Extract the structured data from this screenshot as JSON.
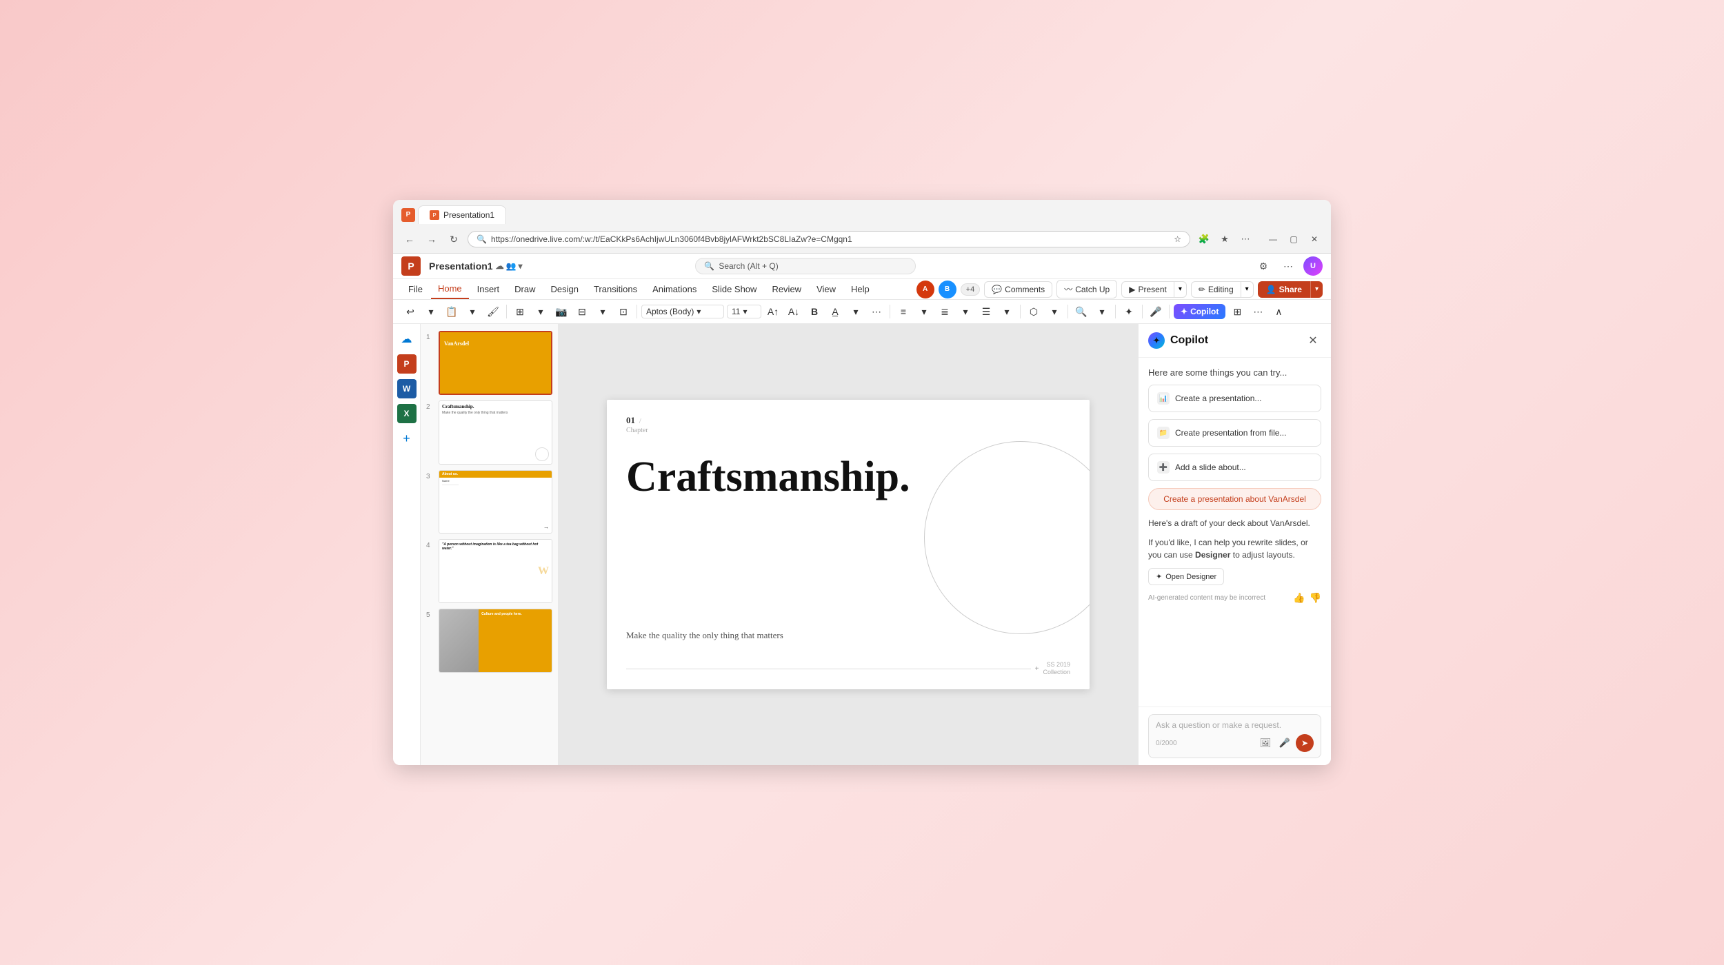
{
  "browser": {
    "url": "https://onedrive.live.com/:w:/t/EaCKkPs6AchIjwULn3060f4Bvb8jylAFWrkt2bSC8LIaZw?e=CMgqn1",
    "tab_label": "Presentation1"
  },
  "app": {
    "title": "Presentation1",
    "search_placeholder": "Search (Alt + Q)"
  },
  "menu": {
    "items": [
      "File",
      "Home",
      "Insert",
      "Draw",
      "Design",
      "Transitions",
      "Animations",
      "Slide Show",
      "Review",
      "View",
      "Help"
    ],
    "active": "Home"
  },
  "toolbar": {
    "font": "Aptos (Body)",
    "font_size": "11",
    "copilot_label": "Copilot"
  },
  "ribbon_actions": {
    "comments": "Comments",
    "catch_up": "Catch Up",
    "present": "Present",
    "editing": "Editing",
    "share": "Share"
  },
  "slides": [
    {
      "num": "1",
      "type": "title_slide"
    },
    {
      "num": "2",
      "type": "craftsmanship"
    },
    {
      "num": "3",
      "type": "about"
    },
    {
      "num": "4",
      "type": "quote"
    },
    {
      "num": "5",
      "type": "culture"
    }
  ],
  "main_slide": {
    "chapter_num": "01",
    "chapter_sep": "/",
    "chapter_label": "Chapter",
    "title": "Craftsmanship.",
    "subtitle": "Make the quality the only thing that matters",
    "footer_year": "SS 2019",
    "footer_collection": "Collection"
  },
  "copilot": {
    "title": "Copilot",
    "hint": "Here are some things you can try...",
    "actions": [
      {
        "label": "Create a presentation...",
        "icon": "📊"
      },
      {
        "label": "Create presentation from file...",
        "icon": "📁"
      },
      {
        "label": "Add a slide about...",
        "icon": "➕"
      }
    ],
    "generate_btn": "Create a presentation about VanArsdel",
    "message_1": "Here's a draft of your deck about VanArsdel.",
    "message_2_pre": "If you'd like, I can help you rewrite slides, or you can use ",
    "message_2_designer": "Designer",
    "message_2_post": " to adjust layouts.",
    "open_designer": "Open Designer",
    "ai_notice": "AI-generated content may be incorrect",
    "input_placeholder": "Ask a question or make a request.",
    "char_count": "0/2000"
  },
  "slide4": {
    "quote": "\"A person without imagination is like a tea bag without hot water.\""
  }
}
